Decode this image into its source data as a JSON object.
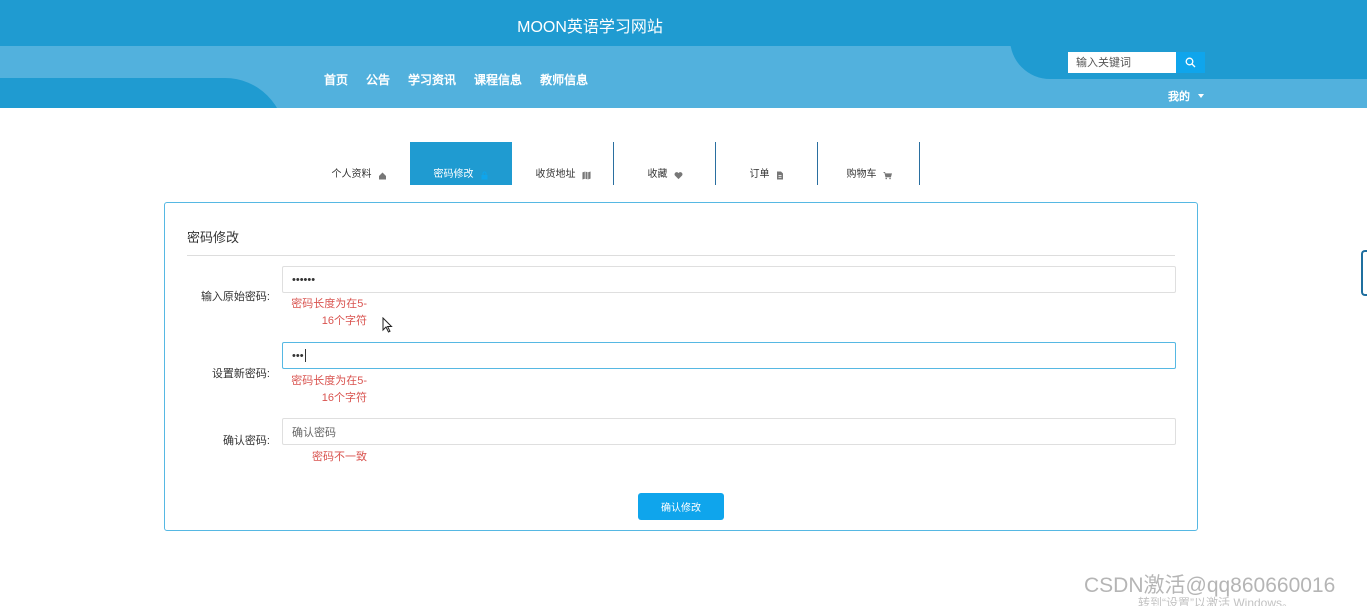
{
  "header": {
    "site_title": "MOON英语学习网站",
    "nav": [
      "首页",
      "公告",
      "学习资讯",
      "课程信息",
      "教师信息"
    ],
    "search_placeholder": "输入关键词",
    "search_icon": "search-icon",
    "mine_label": "我的"
  },
  "tabs": [
    {
      "label": "个人资料",
      "icon": "home-icon",
      "active": false
    },
    {
      "label": "密码修改",
      "icon": "lock-icon",
      "active": true
    },
    {
      "label": "收货地址",
      "icon": "map-icon",
      "active": false
    },
    {
      "label": "收藏",
      "icon": "heart-icon",
      "active": false
    },
    {
      "label": "订单",
      "icon": "file-icon",
      "active": false
    },
    {
      "label": "购物车",
      "icon": "cart-icon",
      "active": false
    }
  ],
  "form": {
    "title": "密码修改",
    "old_password": {
      "label": "输入原始密码:",
      "value": "••••••",
      "error_line1": "密码长度为在5-",
      "error_line2": "16个字符"
    },
    "new_password": {
      "label": "设置新密码:",
      "value": "•••",
      "error_line1": "密码长度为在5-",
      "error_line2": "16个字符"
    },
    "confirm_password": {
      "label": "确认密码:",
      "placeholder": "确认密码",
      "error": "密码不一致"
    },
    "submit_label": "确认修改"
  },
  "watermark": {
    "line1": "CSDN激活@qq860660016",
    "line2": "转到“设置”以激活 Windows。"
  },
  "colors": {
    "primary": "#1f9bd1",
    "band": "#52b1dd",
    "accent": "#0fa5ec",
    "error": "#d9534f"
  }
}
